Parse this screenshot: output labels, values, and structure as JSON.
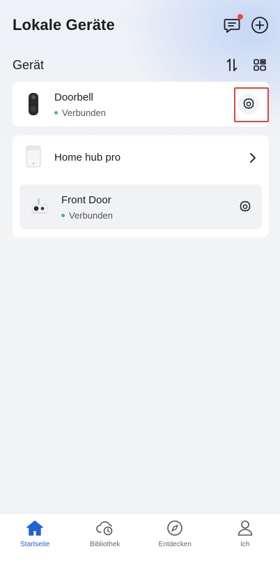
{
  "header": {
    "title": "Lokale Geräte"
  },
  "section": {
    "title": "Gerät"
  },
  "devices": [
    {
      "name": "Doorbell",
      "status": "Verbunden"
    }
  ],
  "hub": {
    "name": "Home hub pro",
    "children": [
      {
        "name": "Front Door",
        "status": "Verbunden"
      }
    ]
  },
  "tabs": [
    {
      "label": "Startseite",
      "icon": "home-icon",
      "active": true
    },
    {
      "label": "Bibliothek",
      "icon": "cloud-clock-icon",
      "active": false
    },
    {
      "label": "Entdecken",
      "icon": "compass-icon",
      "active": false
    },
    {
      "label": "Ich",
      "icon": "person-icon",
      "active": false
    }
  ],
  "colors": {
    "accent": "#1f63d6",
    "status_ok": "#3cbf83",
    "notification": "#f04b3a",
    "highlight": "#e0463b"
  }
}
